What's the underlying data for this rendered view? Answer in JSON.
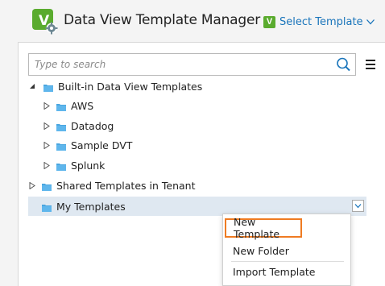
{
  "header": {
    "title": "Data View Template Manager",
    "select_template_label": "Select Template",
    "select_template_badge": "V",
    "logo_letter": "V",
    "logo_color": "#5aab2e"
  },
  "search": {
    "placeholder": "Type to search",
    "value": ""
  },
  "tree": {
    "root_builtin": {
      "label": "Built-in Data View Templates",
      "expanded": true
    },
    "builtin_children": [
      {
        "label": "AWS"
      },
      {
        "label": "Datadog"
      },
      {
        "label": "Sample DVT"
      },
      {
        "label": "Splunk"
      }
    ],
    "root_shared": {
      "label": "Shared Templates in Tenant",
      "expanded": false
    },
    "root_my": {
      "label": "My Templates",
      "selected": true
    }
  },
  "context_menu": {
    "items": [
      {
        "label": "New Template",
        "highlighted": true
      },
      {
        "label": "New Folder"
      },
      {
        "label": "Import Template"
      }
    ]
  },
  "colors": {
    "accent_blue": "#1a75bb",
    "folder_blue": "#4aa6e0",
    "selected_row": "#dfe8f1",
    "highlight_orange": "#ef7b22"
  }
}
